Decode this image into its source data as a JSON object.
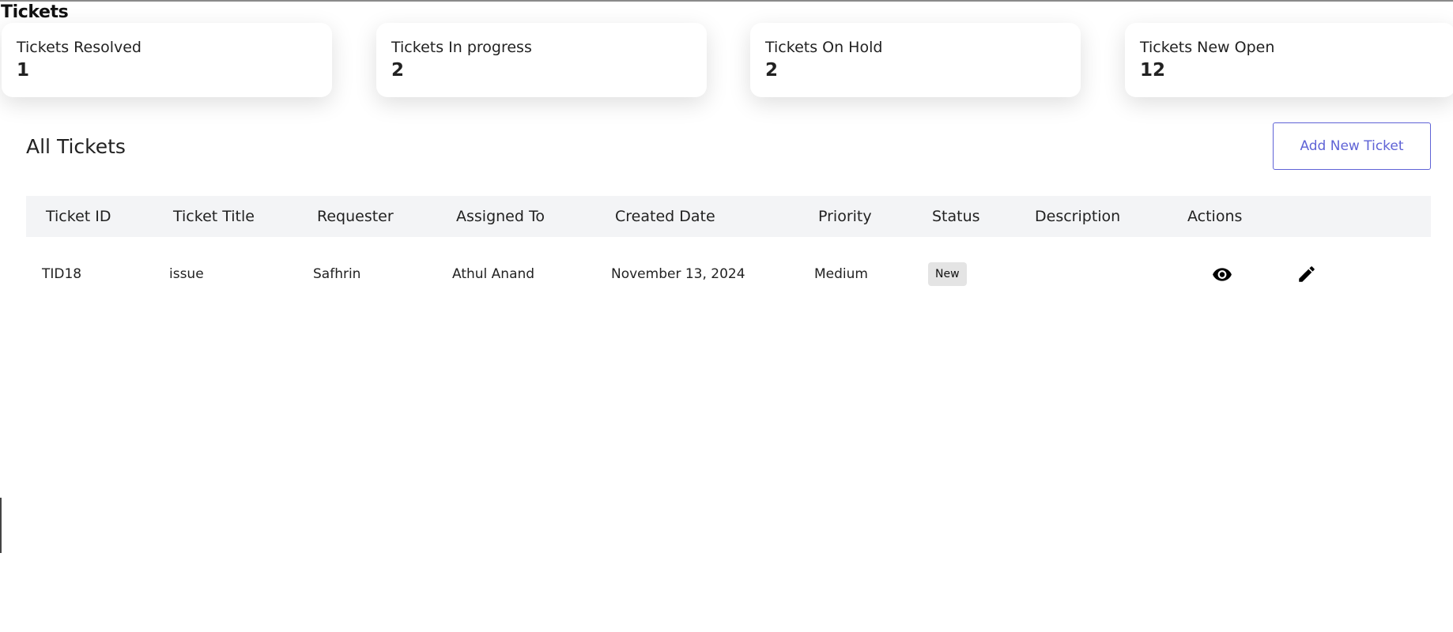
{
  "page": {
    "title": "Tickets"
  },
  "stats": [
    {
      "label": "Tickets Resolved",
      "value": "1"
    },
    {
      "label": "Tickets In progress",
      "value": "2"
    },
    {
      "label": "Tickets On Hold",
      "value": "2"
    },
    {
      "label": "Tickets New Open",
      "value": "12"
    }
  ],
  "tickets_section": {
    "title": "All Tickets",
    "add_button_label": "Add New Ticket"
  },
  "table": {
    "columns": [
      "Ticket ID",
      "Ticket Title",
      "Requester",
      "Assigned To",
      "Created Date",
      "Priority",
      "Status",
      "Description",
      "Actions"
    ],
    "rows": [
      {
        "ticket_id": "TID18",
        "ticket_title": "issue",
        "requester": "Safhrin",
        "assigned_to": "Athul Anand",
        "created_date": "November 13, 2024",
        "priority": "Medium",
        "status": "New",
        "description": "",
        "actions": [
          "eye-icon",
          "pencil-icon"
        ]
      }
    ]
  },
  "colors": {
    "accent": "#5f63d6",
    "header_bg": "#f3f4f6",
    "badge_bg": "#e4e4e4"
  }
}
